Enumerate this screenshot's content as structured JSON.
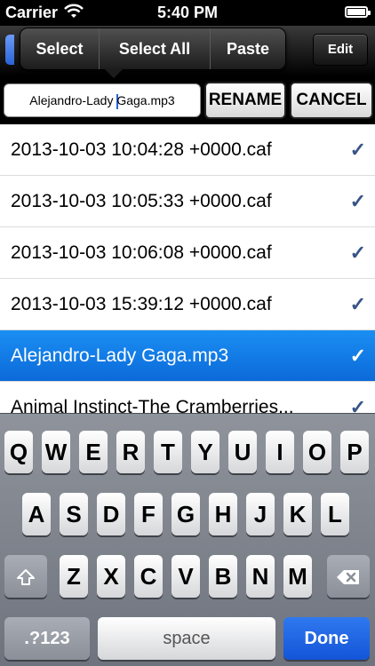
{
  "status_bar": {
    "carrier": "Carrier",
    "time": "5:40 PM",
    "wifi_icon": "wifi-icon",
    "battery_icon": "battery-icon"
  },
  "navbar": {
    "edit_label": "Edit"
  },
  "edit_menu": {
    "select": "Select",
    "select_all": "Select All",
    "paste": "Paste"
  },
  "rename_bar": {
    "input_value": "Alejandro-Lady Gaga.mp3",
    "input_before_caret": "Alejandro-Lady ",
    "input_after_caret": "Gaga.mp3",
    "rename_label": "RENAME",
    "cancel_label": "CANCEL"
  },
  "file_list": {
    "check_glyph": "✓",
    "items": [
      {
        "name": "2013-10-03 10:04:28 +0000.caf",
        "selected": false
      },
      {
        "name": "2013-10-03 10:05:33 +0000.caf",
        "selected": false
      },
      {
        "name": "2013-10-03 10:06:08 +0000.caf",
        "selected": false
      },
      {
        "name": "2013-10-03 15:39:12 +0000.caf",
        "selected": false
      },
      {
        "name": "Alejandro-Lady Gaga.mp3",
        "selected": true
      },
      {
        "name": "Animal Instinct-The Cramberries...",
        "selected": false
      }
    ]
  },
  "keyboard": {
    "row1": [
      "Q",
      "W",
      "E",
      "R",
      "T",
      "Y",
      "U",
      "I",
      "O",
      "P"
    ],
    "row2": [
      "A",
      "S",
      "D",
      "F",
      "G",
      "H",
      "J",
      "K",
      "L"
    ],
    "row3": [
      "Z",
      "X",
      "C",
      "V",
      "B",
      "N",
      "M"
    ],
    "numbers_label": ".?123",
    "space_label": "space",
    "done_label": "Done",
    "shift_icon": "shift-icon",
    "delete_icon": "delete-icon"
  },
  "colors": {
    "accent": "#1a8ef3",
    "checkmark": "#385487",
    "done": "#1455d8"
  }
}
